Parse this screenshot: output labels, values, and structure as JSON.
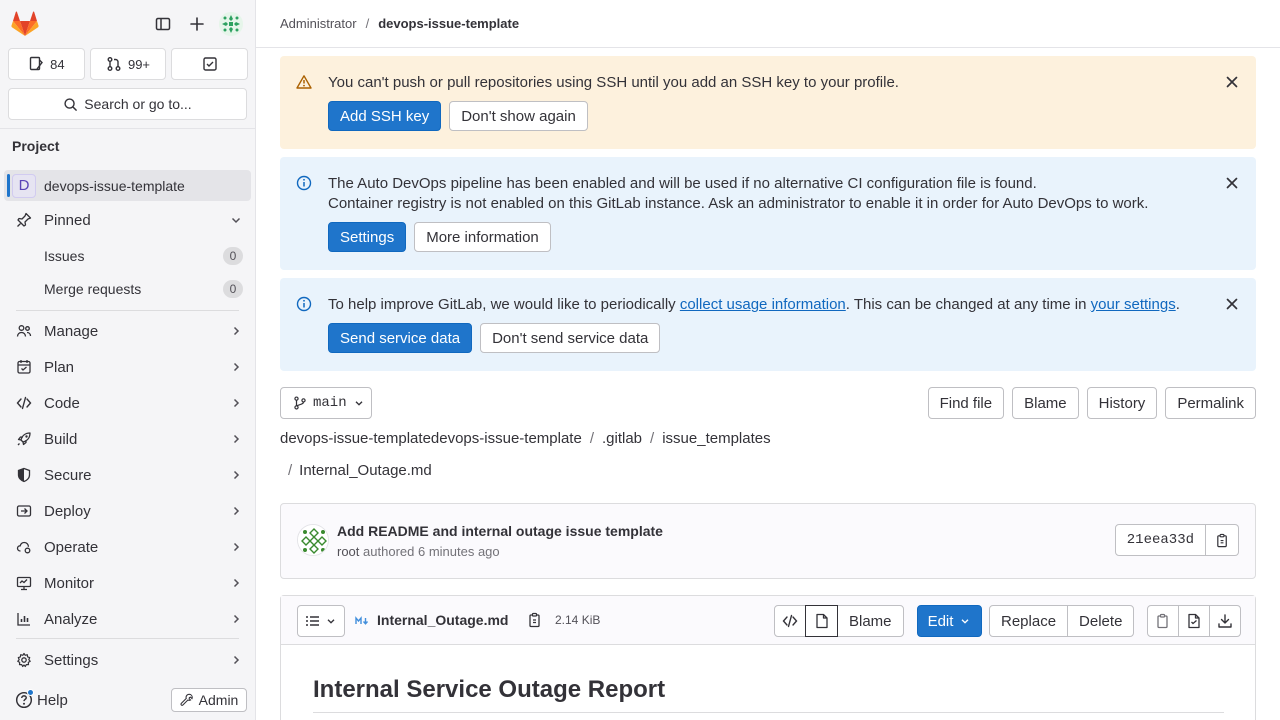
{
  "sidebar": {
    "counts": {
      "issues": "84",
      "merge_requests": "99+"
    },
    "search_label": "Search or go to...",
    "section_title": "Project",
    "project": {
      "avatar_letter": "D",
      "name": "devops-issue-template"
    },
    "pinned": {
      "label": "Pinned",
      "items": [
        {
          "label": "Issues",
          "count": "0"
        },
        {
          "label": "Merge requests",
          "count": "0"
        }
      ]
    },
    "nav": [
      {
        "label": "Manage",
        "icon": "users-icon"
      },
      {
        "label": "Plan",
        "icon": "planning-icon"
      },
      {
        "label": "Code",
        "icon": "code-icon"
      },
      {
        "label": "Build",
        "icon": "rocket-icon"
      },
      {
        "label": "Secure",
        "icon": "shield-icon"
      },
      {
        "label": "Deploy",
        "icon": "deploy-icon"
      },
      {
        "label": "Operate",
        "icon": "cloud-gear-icon"
      },
      {
        "label": "Monitor",
        "icon": "monitor-icon"
      },
      {
        "label": "Analyze",
        "icon": "chart-icon"
      },
      {
        "label": "Settings",
        "icon": "settings-icon"
      }
    ],
    "help_label": "Help",
    "admin_label": "Admin"
  },
  "breadcrumb": {
    "parent": "Administrator",
    "current": "devops-issue-template"
  },
  "alerts": {
    "ssh": {
      "text": "You can't push or pull repositories using SSH until you add an SSH key to your profile.",
      "primary": "Add SSH key",
      "secondary": "Don't show again"
    },
    "devops": {
      "line1": "The Auto DevOps pipeline has been enabled and will be used if no alternative CI configuration file is found.",
      "line2": "Container registry is not enabled on this GitLab instance. Ask an administrator to enable it in order for Auto DevOps to work.",
      "primary": "Settings",
      "secondary": "More information"
    },
    "usage": {
      "text_before": "To help improve GitLab, we would like to periodically ",
      "link1": "collect usage information",
      "text_mid": ". This can be changed at any time in ",
      "link2": "your settings",
      "text_after": ".",
      "primary": "Send service data",
      "secondary": "Don't send service data"
    }
  },
  "repo": {
    "branch": "main",
    "actions": [
      "Find file",
      "Blame",
      "History",
      "Permalink"
    ],
    "path": {
      "root": "devops-issue-templatedevops-issue-template",
      "dir1": ".gitlab",
      "dir2": "issue_templates",
      "file": "Internal_Outage.md"
    }
  },
  "commit": {
    "title": "Add README and internal outage issue template",
    "author": "root",
    "action": "authored",
    "time": "6 minutes ago",
    "sha": "21eea33d"
  },
  "file": {
    "name": "Internal_Outage.md",
    "size": "2.14 KiB",
    "blame_label": "Blame",
    "edit_label": "Edit",
    "replace_label": "Replace",
    "delete_label": "Delete",
    "heading": "Internal Service Outage Report"
  }
}
